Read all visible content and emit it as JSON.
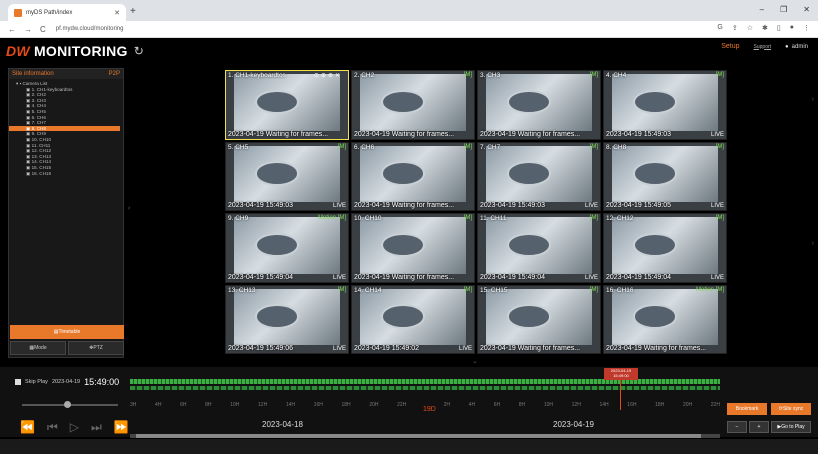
{
  "browser": {
    "tab_title": "myDS Path/index",
    "url": "pf.mydw.cloud/monitoring",
    "new_tab": "+",
    "window_controls": [
      "v",
      "–",
      "❐",
      "✕"
    ]
  },
  "header": {
    "logo_dw": "DW",
    "title": "MONITORING",
    "setup": "Setup",
    "support": "Support",
    "user": "admin"
  },
  "sidebar": {
    "title": "Site information",
    "p2p": "P2P",
    "root": "Camera List",
    "cameras": [
      "1. CH1-keyboardtos",
      "2. CH2",
      "3. CH3",
      "4. CH4",
      "5. CH5",
      "6. CH6",
      "7. CH7",
      "8. CH8",
      "9. CH9",
      "10. CH10",
      "11. CH11",
      "12. CH12",
      "13. CH13",
      "14. CH14",
      "15. CH15",
      "16. CH16"
    ],
    "selected_index": 7,
    "timetable": "Timetable",
    "mode": "Mode",
    "ptz": "PTZ"
  },
  "cells": [
    {
      "label": "1. CH1-keyboardtos",
      "tag": "",
      "ts": "2023-04-19  Waiting for frames...",
      "live": "",
      "selected": true
    },
    {
      "label": "2. CH2",
      "tag": "[M]",
      "ts": "2023-04-19  Waiting for frames...",
      "live": ""
    },
    {
      "label": "3. CH3",
      "tag": "[M]",
      "ts": "2023-04-19  Waiting for frames...",
      "live": ""
    },
    {
      "label": "4. CH4",
      "tag": "[M]",
      "ts": "2023-04-19 15:49:03",
      "live": "LIVE"
    },
    {
      "label": "5. CH5",
      "tag": "[M]",
      "ts": "2023-04-19 15:49:03",
      "live": "LIVE"
    },
    {
      "label": "6. CH6",
      "tag": "[M]",
      "ts": "2023-04-19  Waiting for frames...",
      "live": ""
    },
    {
      "label": "7. CH7",
      "tag": "[M]",
      "ts": "2023-04-19 15:49:03",
      "live": "LIVE"
    },
    {
      "label": "8. CH8",
      "tag": "[M]",
      "ts": "2023-04-19 15:49:05",
      "live": "LIVE"
    },
    {
      "label": "9. CH9",
      "tag": "Motion [M]",
      "ts": "2023-04-19 15:49:04",
      "live": "LIVE"
    },
    {
      "label": "10. CH10",
      "tag": "[M]",
      "ts": "2023-04-19  Waiting for frames...",
      "live": ""
    },
    {
      "label": "11. CH11",
      "tag": "[M]",
      "ts": "2023-04-19 15:49:04",
      "live": "LIVE"
    },
    {
      "label": "12. CH12",
      "tag": "[M]",
      "ts": "2023-04-19 15:49:04",
      "live": "LIVE"
    },
    {
      "label": "13. CH13",
      "tag": "[M]",
      "ts": "2023-04-19 15:49:06",
      "live": "LIVE"
    },
    {
      "label": "14. CH14",
      "tag": "[M]",
      "ts": "2023-04-19 15:49:02",
      "live": "LIVE"
    },
    {
      "label": "15. CH15",
      "tag": "[M]",
      "ts": "2023-04-19  Waiting for frames...",
      "live": ""
    },
    {
      "label": "16. CH16",
      "tag": "Motion [M]",
      "ts": "2023-04-19  Waiting for frames...",
      "live": ""
    }
  ],
  "timeline": {
    "skip_play": "Skip Play",
    "date": "2023-04-19",
    "time": "15:49:00",
    "ticks": [
      "3H",
      "4H",
      "6H",
      "8H",
      "10H",
      "12H",
      "14H",
      "16H",
      "18H",
      "20H",
      "22H",
      "",
      "2H",
      "4H",
      "6H",
      "8H",
      "10H",
      "12H",
      "14H",
      "16H",
      "18H",
      "20H",
      "22H"
    ],
    "day1": "2023-04-18",
    "day2": "2023-04-19",
    "marker": "2023-04-19 15:49:00",
    "day_mark": "19D"
  },
  "controls": {
    "bookmark": "Bookmark",
    "site_sync": "Site sync",
    "zoom_out": "−",
    "zoom_in": "+",
    "go_to_play": "Go to Play"
  }
}
